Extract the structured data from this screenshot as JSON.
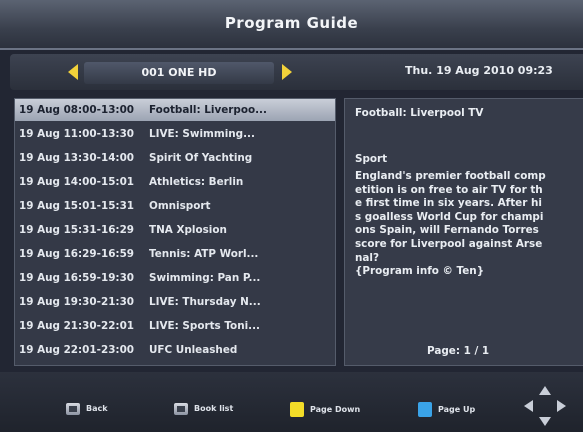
{
  "header": {
    "title": "Program Guide"
  },
  "channel_bar": {
    "channel": "001 ONE HD",
    "datetime": "Thu.  19 Aug 2010 09:23"
  },
  "programs": [
    {
      "time": "19 Aug 08:00-13:00",
      "name": "Football: Liverpoo..."
    },
    {
      "time": "19 Aug 11:00-13:30",
      "name": "LIVE: Swimming..."
    },
    {
      "time": "19 Aug 13:30-14:00",
      "name": "Spirit Of Yachting"
    },
    {
      "time": "19 Aug 14:00-15:01",
      "name": "Athletics: Berlin"
    },
    {
      "time": "19 Aug 15:01-15:31",
      "name": "Omnisport"
    },
    {
      "time": "19 Aug 15:31-16:29",
      "name": "TNA Xplosion"
    },
    {
      "time": "19 Aug 16:29-16:59",
      "name": "Tennis: ATP Worl..."
    },
    {
      "time": "19 Aug 16:59-19:30",
      "name": "Swimming: Pan P..."
    },
    {
      "time": "19 Aug 19:30-21:30",
      "name": "LIVE: Thursday N..."
    },
    {
      "time": "19 Aug 21:30-22:01",
      "name": "LIVE: Sports Toni..."
    },
    {
      "time": "19 Aug 22:01-23:00",
      "name": "UFC Unleashed"
    }
  ],
  "info": {
    "title": "Football: Liverpool TV",
    "genre": "Sport",
    "description_lines": [
      "England's premier football comp",
      "etition is on free to air TV for th",
      "e first time in six years. After hi",
      "s goalless World Cup for champi",
      "ons Spain, will Fernando Torres",
      "score for Liverpool against Arse",
      "nal?",
      "{Program info © Ten}"
    ],
    "page": "Page:  1 / 1"
  },
  "help": {
    "back": "Back",
    "book_list": "Book list",
    "page_down": "Page Down",
    "page_up": "Page Up"
  },
  "colors": {
    "yellow_key": "#f2dc28",
    "blue_key": "#3aa3e8",
    "arrow": "#f2d23a"
  }
}
